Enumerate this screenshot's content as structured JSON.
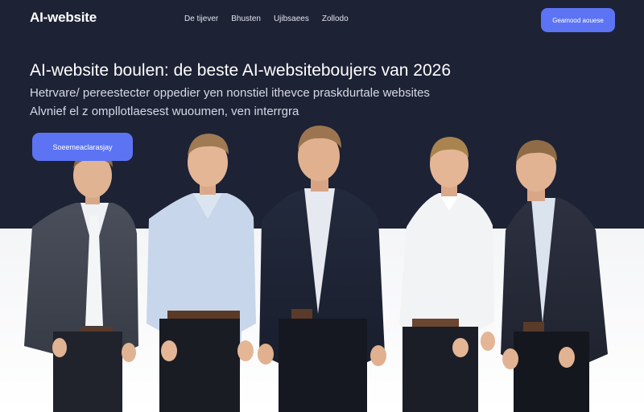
{
  "nav": {
    "logo": "AI-website",
    "links": [
      "De tijever",
      "Bhusten",
      "Ujibsaees",
      "Zollodo"
    ],
    "cta_label": "Geamood aouese"
  },
  "hero": {
    "headline": "AI-website boulen: de beste AI-websiteboujers van 2026",
    "subtitle": "Hetrvare/ pereestecter oppedier yen nonstiel ithevce praskdurtale websites  Alvnief el z ompllotlaesest wuoumen, ven interrgra",
    "cta_label": "Soeemeaclarasjay"
  },
  "photo": {
    "alt": "team-photo",
    "colors": {
      "hero_bg": "#1d2235",
      "accent": "#5c74f3"
    }
  }
}
